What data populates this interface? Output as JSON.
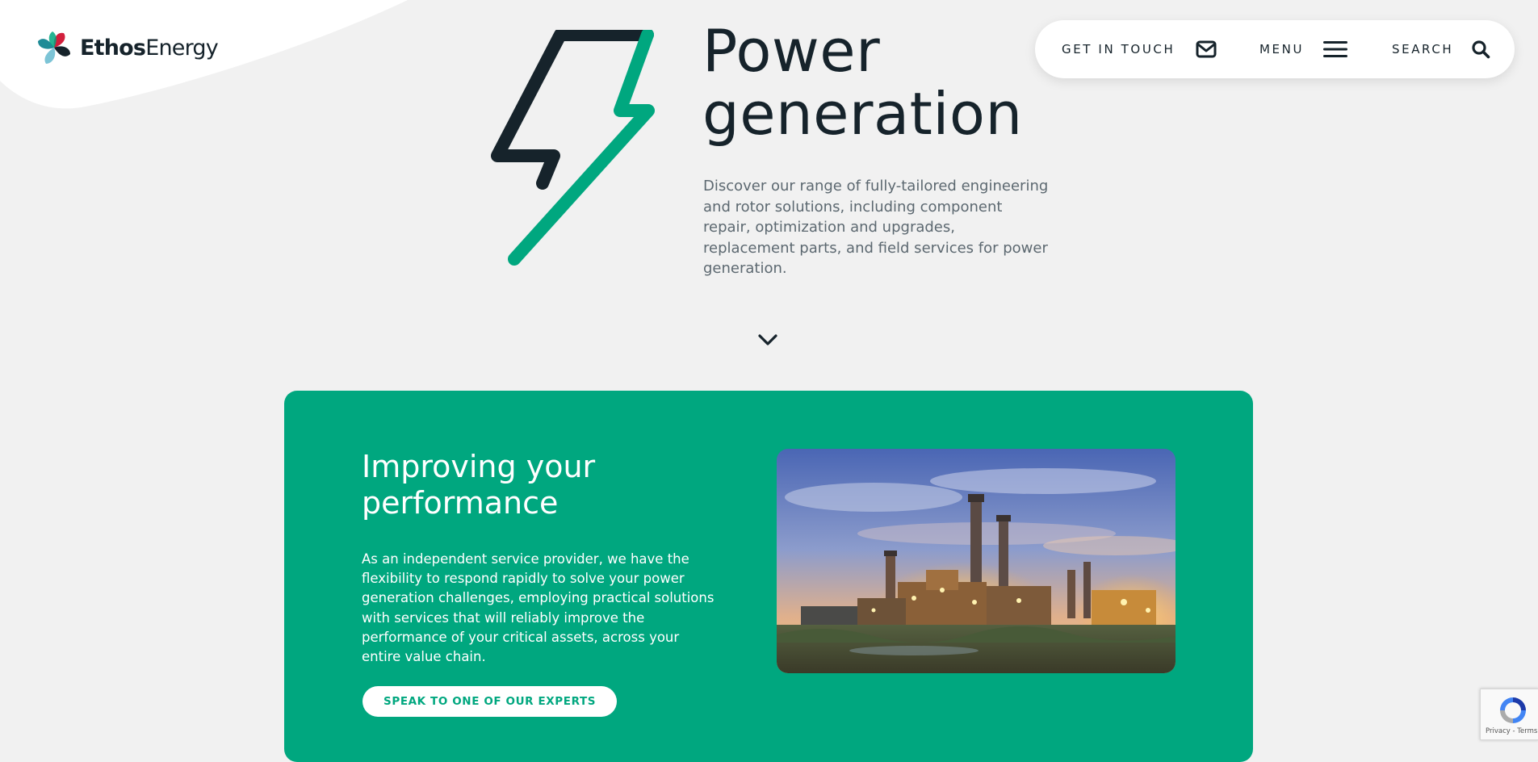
{
  "brand": {
    "name_bold": "Ethos",
    "name_regular": "Energy",
    "colors": {
      "green": "#00a77f",
      "navy": "#16232b",
      "red": "#d21f3c",
      "teal": "#1e8b96",
      "light_blue": "#7cc4d6",
      "background": "#f1f1f1"
    }
  },
  "nav": {
    "get_in_touch": {
      "label": "GET IN TOUCH",
      "icon": "mail-icon"
    },
    "menu": {
      "label": "MENU",
      "icon": "hamburger-icon"
    },
    "search": {
      "label": "SEARCH",
      "icon": "search-icon"
    }
  },
  "hero": {
    "icon": "lightning-bolt-icon",
    "title_line1": "Power",
    "title_line2": "generation",
    "description": "Discover our range of fully-tailored engineering and rotor solutions, including component repair, optimization and upgrades, replacement parts, and field services for power generation.",
    "scroll_icon": "chevron-down-icon"
  },
  "feature_card": {
    "title_line1": "Improving your",
    "title_line2": "performance",
    "text": "As an independent service provider, we have the flexibility to respond rapidly to solve your power generation challenges, employing practical solutions with services that will reliably improve the performance of your critical assets, across your entire value chain.",
    "cta_label": "SPEAK TO ONE OF OUR EXPERTS",
    "image_subject": "power-plant-at-dusk"
  },
  "recaptcha": {
    "privacy": "Privacy",
    "separator": " - ",
    "terms": "Terms"
  }
}
